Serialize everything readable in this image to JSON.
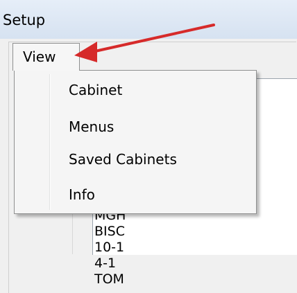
{
  "window": {
    "title": "Setup"
  },
  "menubar": {
    "view_label": "View"
  },
  "dropdown": {
    "items": [
      {
        "label": "Cabinet"
      },
      {
        "label": "Menus"
      },
      {
        "label": "Saved Cabinets"
      },
      {
        "label": "Info"
      }
    ]
  },
  "list": {
    "items": [
      "MGH",
      "BISC",
      "10-1",
      "4-1",
      "TOM"
    ]
  },
  "colors": {
    "arrow": "#d62a2a",
    "titlebar": "#dde7f4"
  }
}
